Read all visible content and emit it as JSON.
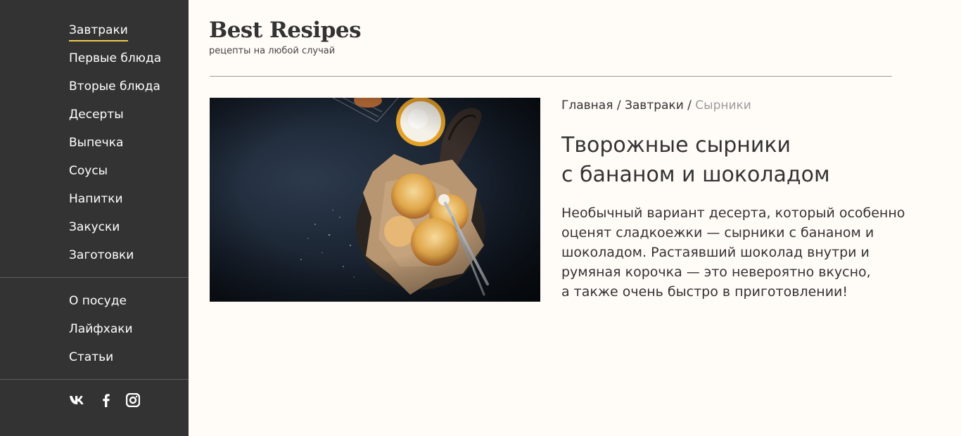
{
  "sidebar": {
    "categories": [
      {
        "label": "Завтраки",
        "active": true
      },
      {
        "label": "Первые блюда"
      },
      {
        "label": "Вторые блюда"
      },
      {
        "label": "Десерты"
      },
      {
        "label": "Выпечка"
      },
      {
        "label": "Соусы"
      },
      {
        "label": "Напитки"
      },
      {
        "label": "Закуски"
      },
      {
        "label": "Заготовки"
      }
    ],
    "secondary": [
      {
        "label": "О посуде"
      },
      {
        "label": "Лайфхаки"
      },
      {
        "label": "Статьи"
      }
    ],
    "social": [
      "vk-icon",
      "facebook-icon",
      "instagram-icon"
    ]
  },
  "header": {
    "logo": "Best Resipes",
    "tagline": "рецепты на любой случай"
  },
  "breadcrumb": {
    "items": [
      "Главная",
      "Завтраки"
    ],
    "separator": "/",
    "current": "Сырники"
  },
  "article": {
    "title_lines": [
      "Творожные сырники",
      "с бананом и шоколадом"
    ],
    "description_lines": [
      "Необычный вариант десерта, который особенно",
      "оценят сладкоежки — сырники с бананом и",
      "шоколадом. Растаявший шоколад внутри и",
      "румяная корочка — это невероятно вкусно,",
      "а также очень быстро в приготовлении!"
    ],
    "image": "syrniki-photo"
  },
  "colors": {
    "sidebar_bg": "#333333",
    "page_bg": "#fffcf8",
    "accent": "#f2c94c",
    "muted": "#9b9b9b"
  }
}
